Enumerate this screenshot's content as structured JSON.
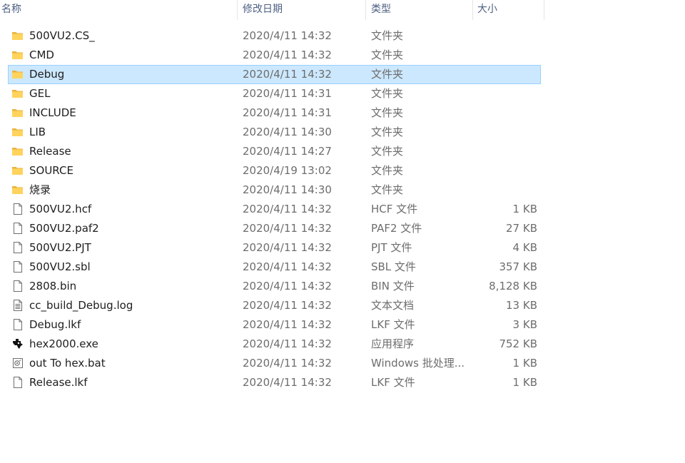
{
  "columns": {
    "name": "名称",
    "date": "修改日期",
    "type": "类型",
    "size": "大小"
  },
  "selected_index": 2,
  "files": [
    {
      "name": "500VU2.CS_",
      "date": "2020/4/11 14:32",
      "type": "文件夹",
      "size": "",
      "icon": "folder-icon"
    },
    {
      "name": "CMD",
      "date": "2020/4/11 14:32",
      "type": "文件夹",
      "size": "",
      "icon": "folder-icon"
    },
    {
      "name": "Debug",
      "date": "2020/4/11 14:32",
      "type": "文件夹",
      "size": "",
      "icon": "folder-icon"
    },
    {
      "name": "GEL",
      "date": "2020/4/11 14:31",
      "type": "文件夹",
      "size": "",
      "icon": "folder-icon"
    },
    {
      "name": "INCLUDE",
      "date": "2020/4/11 14:31",
      "type": "文件夹",
      "size": "",
      "icon": "folder-icon"
    },
    {
      "name": "LIB",
      "date": "2020/4/11 14:30",
      "type": "文件夹",
      "size": "",
      "icon": "folder-icon"
    },
    {
      "name": "Release",
      "date": "2020/4/11 14:27",
      "type": "文件夹",
      "size": "",
      "icon": "folder-icon"
    },
    {
      "name": "SOURCE",
      "date": "2020/4/19 13:02",
      "type": "文件夹",
      "size": "",
      "icon": "folder-icon"
    },
    {
      "name": "烧录",
      "date": "2020/4/11 14:30",
      "type": "文件夹",
      "size": "",
      "icon": "folder-icon"
    },
    {
      "name": "500VU2.hcf",
      "date": "2020/4/11 14:32",
      "type": "HCF 文件",
      "size": "1 KB",
      "icon": "file-icon"
    },
    {
      "name": "500VU2.paf2",
      "date": "2020/4/11 14:32",
      "type": "PAF2 文件",
      "size": "27 KB",
      "icon": "file-icon"
    },
    {
      "name": "500VU2.PJT",
      "date": "2020/4/11 14:32",
      "type": "PJT 文件",
      "size": "4 KB",
      "icon": "file-icon"
    },
    {
      "name": "500VU2.sbl",
      "date": "2020/4/11 14:32",
      "type": "SBL 文件",
      "size": "357 KB",
      "icon": "file-icon"
    },
    {
      "name": "2808.bin",
      "date": "2020/4/11 14:32",
      "type": "BIN 文件",
      "size": "8,128 KB",
      "icon": "file-icon"
    },
    {
      "name": "cc_build_Debug.log",
      "date": "2020/4/11 14:32",
      "type": "文本文档",
      "size": "13 KB",
      "icon": "text-file-icon"
    },
    {
      "name": "Debug.lkf",
      "date": "2020/4/11 14:32",
      "type": "LKF 文件",
      "size": "3 KB",
      "icon": "file-icon"
    },
    {
      "name": "hex2000.exe",
      "date": "2020/4/11 14:32",
      "type": "应用程序",
      "size": "752 KB",
      "icon": "ti-app-icon"
    },
    {
      "name": "out To hex.bat",
      "date": "2020/4/11 14:32",
      "type": "Windows 批处理...",
      "size": "1 KB",
      "icon": "batch-file-icon"
    },
    {
      "name": "Release.lkf",
      "date": "2020/4/11 14:32",
      "type": "LKF 文件",
      "size": "1 KB",
      "icon": "file-icon"
    }
  ]
}
